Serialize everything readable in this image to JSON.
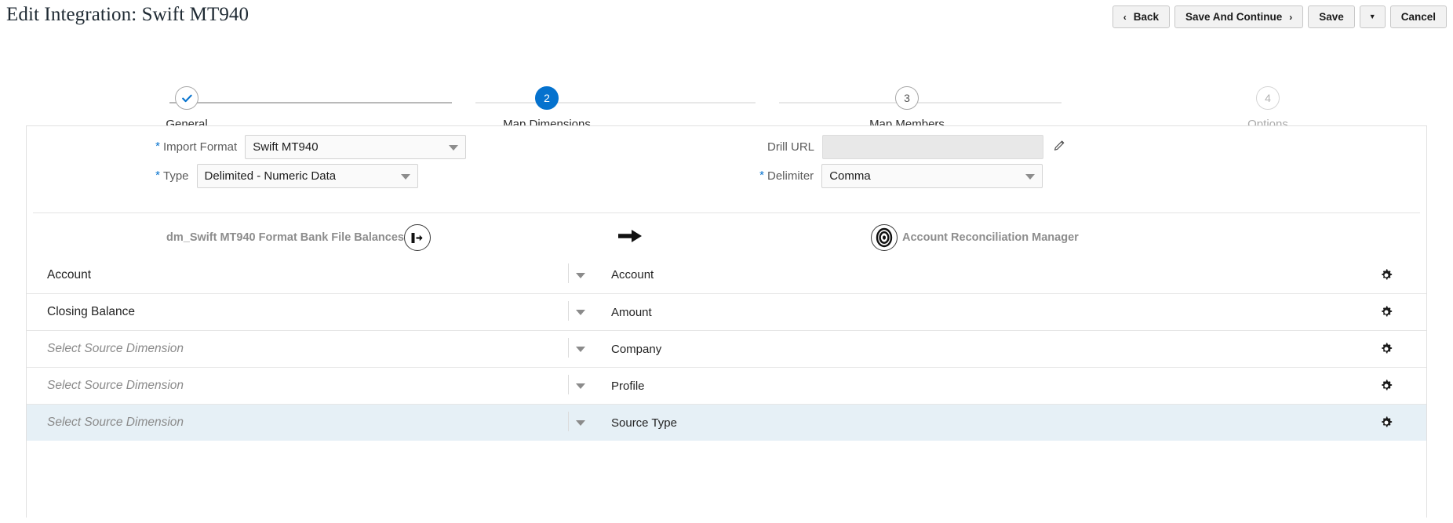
{
  "page": {
    "title": "Edit Integration: Swift MT940"
  },
  "toolbar": {
    "back_label": "Back",
    "back_icon": "chevron-left-icon",
    "save_continue_label": "Save And Continue",
    "save_continue_icon": "chevron-right-icon",
    "save_label": "Save",
    "dropdown_icon": "caret-down-icon",
    "cancel_label": "Cancel",
    "accent_color": "#0572ce"
  },
  "stepper": {
    "current_step": 2,
    "active_color": "#0572ce",
    "steps": [
      {
        "number": "1",
        "label": "General",
        "state": "completed",
        "icon": "check-icon"
      },
      {
        "number": "2",
        "label": "Map Dimensions",
        "state": "current"
      },
      {
        "number": "3",
        "label": "Map Members",
        "state": "upcoming"
      },
      {
        "number": "4",
        "label": "Options",
        "state": "disabled"
      }
    ]
  },
  "form": {
    "import_format": {
      "label": "Import Format",
      "value": "Swift MT940",
      "required": true,
      "caret_icon": "caret-down-icon"
    },
    "type": {
      "label": "Type",
      "value": "Delimited - Numeric Data",
      "required": true,
      "caret_icon": "caret-down-icon"
    },
    "drill_url": {
      "label": "Drill URL",
      "value": "",
      "placeholder": "",
      "required": false,
      "readonly": true,
      "edit_icon": "pencil-icon"
    },
    "delimiter": {
      "label": "Delimiter",
      "value": "Comma",
      "required": true,
      "caret_icon": "caret-down-icon"
    }
  },
  "mapping": {
    "source_header": {
      "label": "dm_Swift MT940 Format Bank File Balances",
      "icon": "source-export-icon"
    },
    "arrow_icon": "arrow-right-icon",
    "target_header": {
      "label": "Account Reconciliation Manager",
      "icon": "target-bullseye-icon"
    },
    "row_caret_icon": "caret-down-icon",
    "row_gear_icon": "gear-icon",
    "source_placeholder": "Select Source Dimension",
    "selected_row_color": "#e6f0f6",
    "rows": [
      {
        "source": "Account",
        "is_placeholder": false,
        "target": "Account",
        "selected": false
      },
      {
        "source": "Closing Balance",
        "is_placeholder": false,
        "target": "Amount",
        "selected": false
      },
      {
        "source": "Select Source Dimension",
        "is_placeholder": true,
        "target": "Company",
        "selected": false
      },
      {
        "source": "Select Source Dimension",
        "is_placeholder": true,
        "target": "Profile",
        "selected": false
      },
      {
        "source": "Select Source Dimension",
        "is_placeholder": true,
        "target": "Source Type",
        "selected": true
      }
    ]
  }
}
